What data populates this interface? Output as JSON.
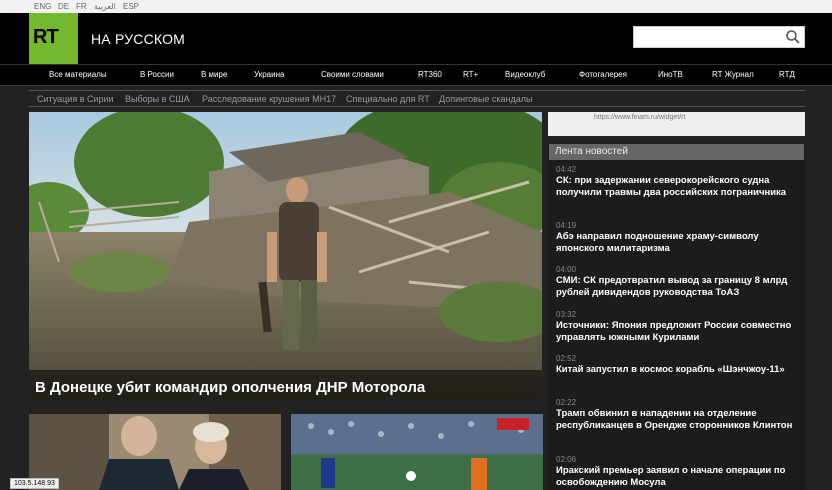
{
  "languages": [
    "ENG",
    "DE",
    "FR",
    "العربية",
    "ESP"
  ],
  "header": {
    "logo": "RT",
    "title": "НА РУССКОМ",
    "search_placeholder": ""
  },
  "mainnav": [
    "Все материалы",
    "В России",
    "В мире",
    "Украина",
    "Своими словами",
    "RT360",
    "RT+",
    "Видеоклуб",
    "Фотогалерея",
    "ИноТВ",
    "RT Журнал",
    "RTД"
  ],
  "subnav": [
    "Ситуация в Сирии",
    "Выборы в США",
    "Расследование крушения MH17",
    "Специально для RT",
    "Допинговые скандалы"
  ],
  "hero": {
    "title": "В Донецке убит командир ополчения ДНР Моторола"
  },
  "widget": {
    "url": "https://www.finam.ru/widget/rt"
  },
  "feed": {
    "heading": "Лента новостей",
    "items": [
      {
        "time": "04:42",
        "text": "СК: при задержании северокорейского судна получили травмы два российских пограничника"
      },
      {
        "time": "04:19",
        "text": "Абэ направил подношение храму-символу японского милитаризма"
      },
      {
        "time": "04:00",
        "text": "СМИ: СК предотвратил вывод за границу 8 млрд рублей дивидендов руководства ТоАЗ"
      },
      {
        "time": "03:32",
        "text": "Источники: Япония предложит России совместно управлять южными Курилами"
      },
      {
        "time": "02:52",
        "text": "Китай запустил в космос корабль «Шэнчжоу-11»"
      },
      {
        "time": "02:22",
        "text": "Трамп обвинил в нападении на отделение республиканцев в Орендже сторонников Клинтон"
      },
      {
        "time": "02:06",
        "text": "Иракский премьер заявил о начале операции по освобождению Мосула"
      }
    ]
  },
  "status": {
    "ip": "103.5.148.93"
  },
  "colors": {
    "brand": "#74b82f",
    "background": "#222222"
  }
}
